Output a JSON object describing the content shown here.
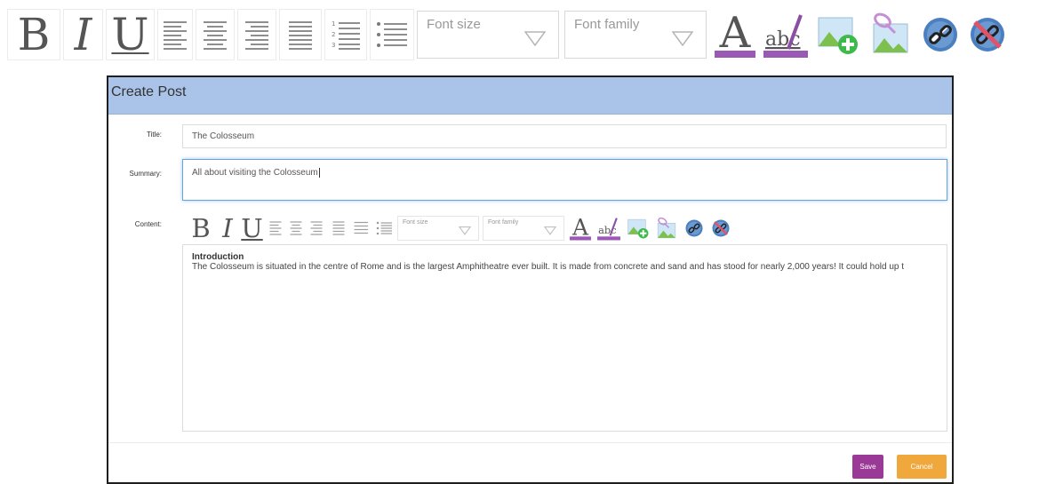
{
  "toolbar": {
    "font_size_placeholder": "Font size",
    "font_family_placeholder": "Font family",
    "buttons": {
      "bold": "B",
      "italic": "I",
      "underline": "U",
      "font_color": "A",
      "background_color": "abc"
    }
  },
  "dialog": {
    "title": "Create Post",
    "labels": {
      "title": "Title:",
      "summary": "Summary:",
      "content": "Content:"
    },
    "fields": {
      "title_value": "The Colosseum",
      "summary_value": "All about visiting the Colosseum"
    },
    "content": {
      "heading": "Introduction",
      "body": "The Colosseum is situated in the centre of Rome and is the largest Amphitheatre ever built. It is made from concrete and sand and has stood for nearly 2,000 years! It could hold up t"
    },
    "save_label": "Save",
    "cancel_label": "Cancel"
  },
  "colors": {
    "header_bg": "#a9c4e8",
    "save_bg": "#9b3a96",
    "cancel_bg": "#f0a83c",
    "format_underline": "#9b59b6",
    "image_green": "#3cba4a",
    "link_blue": "#4a7fc0"
  },
  "icons": [
    "bold-icon",
    "italic-icon",
    "underline-icon",
    "align-left-icon",
    "align-center-icon",
    "align-right-icon",
    "align-justify-icon",
    "ordered-list-icon",
    "unordered-list-icon",
    "chevron-down-icon",
    "font-color-icon",
    "highlight-icon",
    "insert-image-icon",
    "edit-image-icon",
    "link-icon",
    "unlink-icon"
  ]
}
